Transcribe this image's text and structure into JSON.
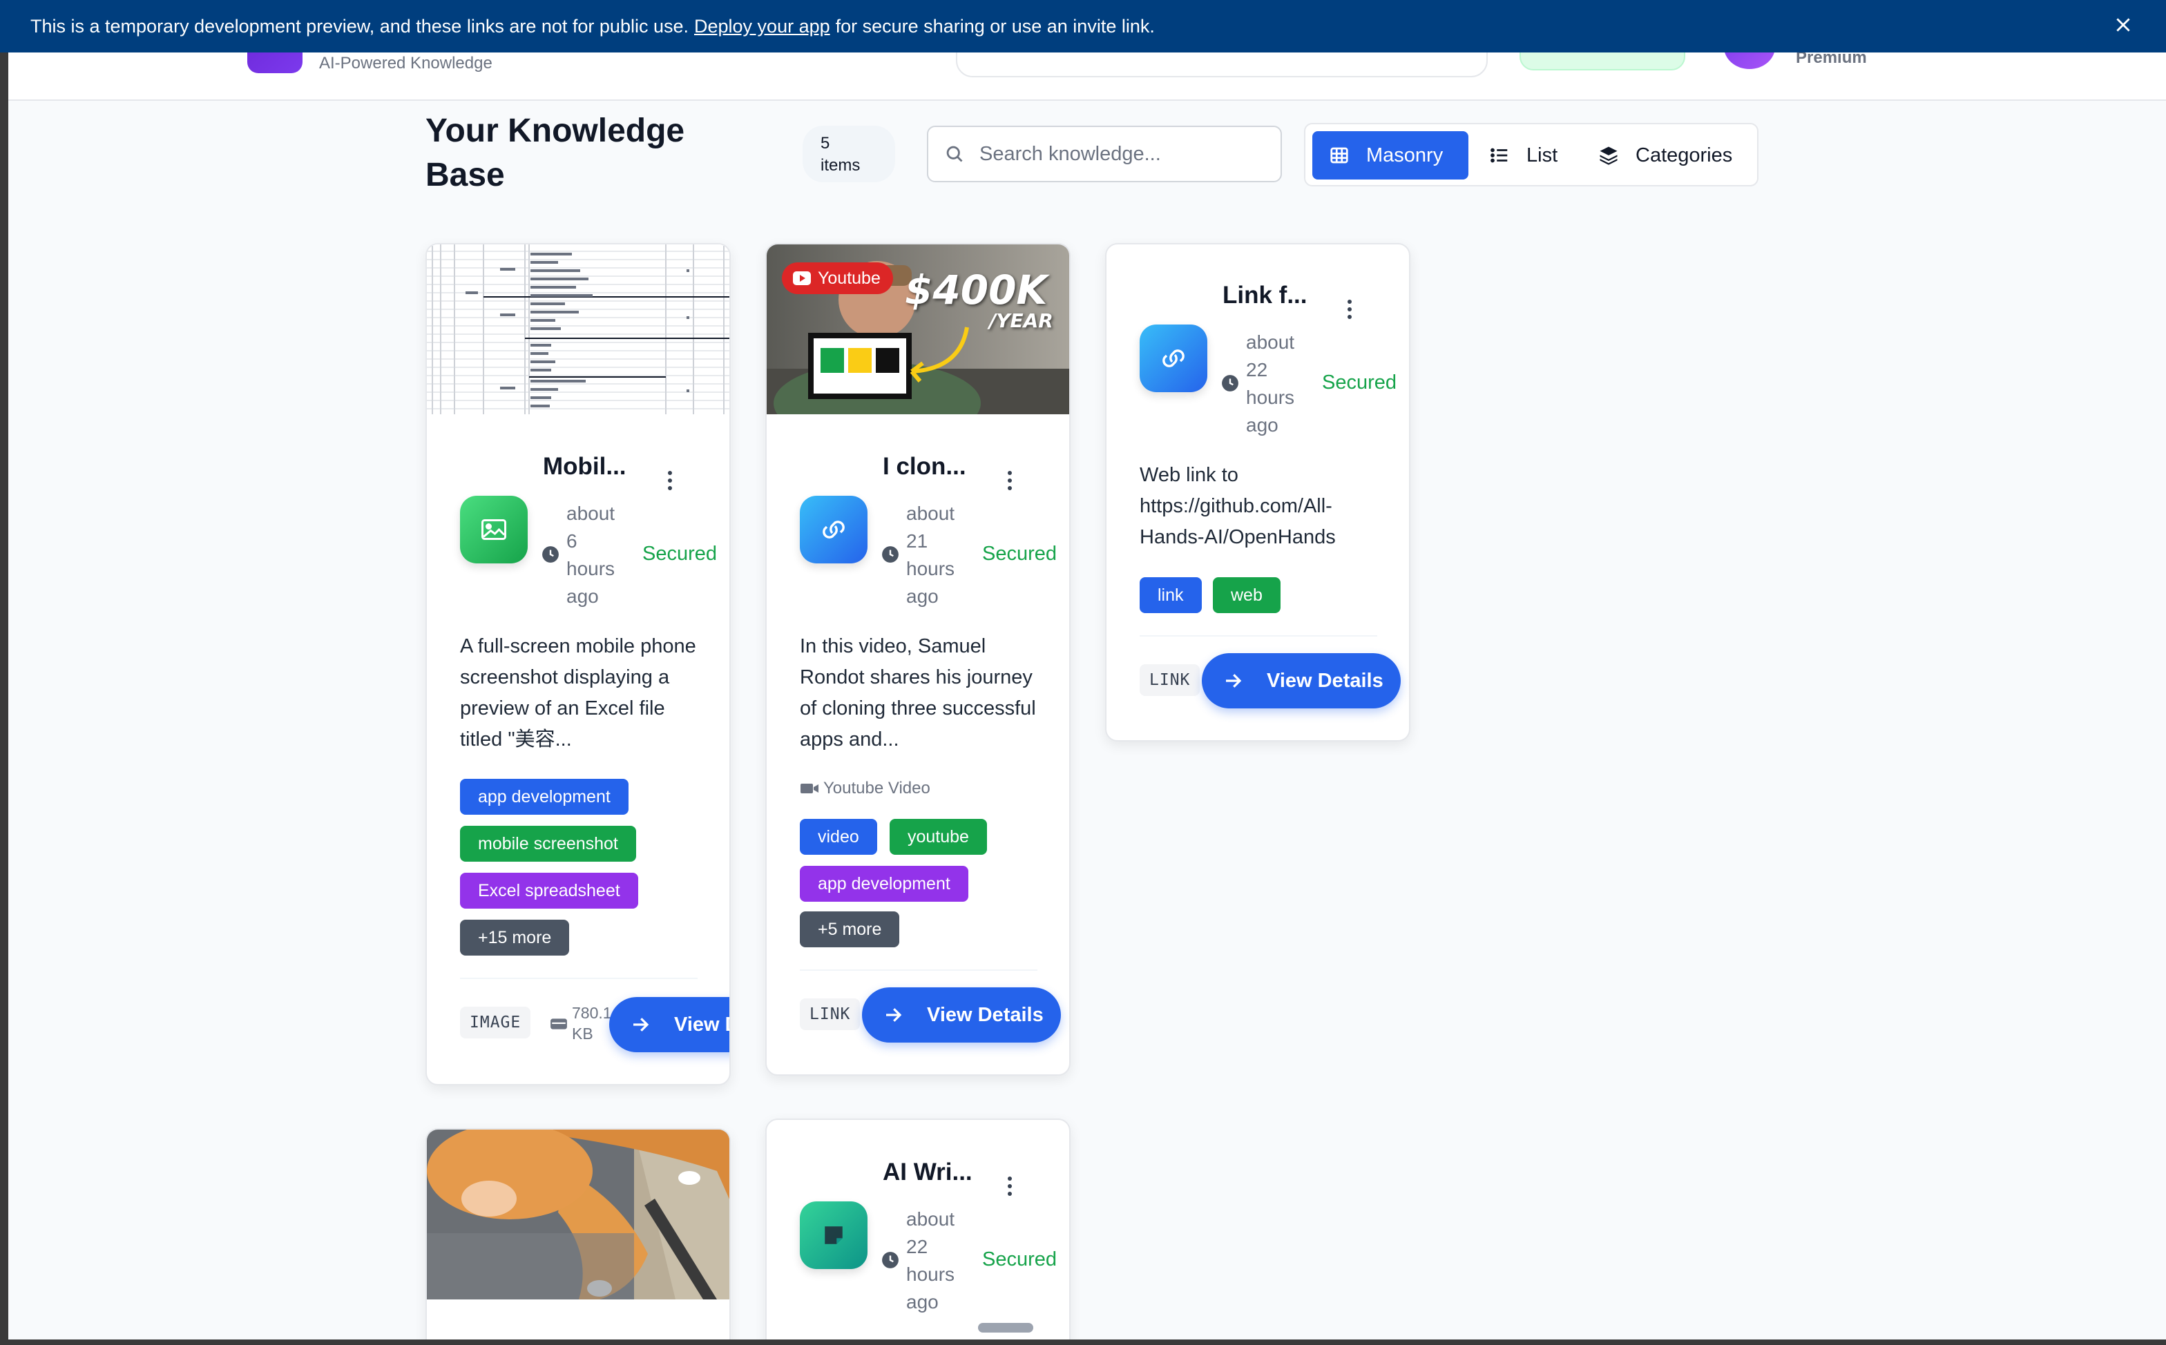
{
  "banner": {
    "text_before": "This is a temporary development preview, and these links are not for public use.",
    "link": "Deploy your app",
    "text_after": "for secure sharing or use an invite link."
  },
  "header": {
    "subtitle": "AI-Powered Knowledge",
    "plan": "Premium"
  },
  "toolbar": {
    "title": "Your Knowledge Base",
    "count_number": "5",
    "count_unit": "items",
    "search_placeholder": "Search knowledge...",
    "views": [
      "Masonry",
      "List",
      "Categories"
    ]
  },
  "colors": {
    "primary": "#2563eb",
    "secured": "#16a34a",
    "banner": "#003e7e"
  },
  "cards": [
    {
      "title": "Mobil...",
      "icon": "image-icon",
      "time": [
        "about",
        "6",
        "hours",
        "ago"
      ],
      "status": "Secured",
      "description": "A full-screen mobile phone screenshot displaying a preview of an Excel file titled \"美容...",
      "tags": [
        "app development",
        "mobile screenshot",
        "Excel spreadsheet",
        "+15 more"
      ],
      "type": "IMAGE",
      "size": [
        "780.1",
        "KB"
      ],
      "button": "View Details"
    },
    {
      "title": "I clon...",
      "icon": "link-icon",
      "badge": "Youtube",
      "thumb_text": [
        "$400K",
        "/YEAR"
      ],
      "time": [
        "about",
        "21",
        "hours",
        "ago"
      ],
      "status": "Secured",
      "description": "In this video, Samuel Rondot shares his journey of cloning three successful apps and...",
      "source": "Youtube Video",
      "tags": [
        "video",
        "youtube",
        "app development",
        "+5 more"
      ],
      "type": "LINK",
      "button": "View Details"
    },
    {
      "title": "Link f...",
      "icon": "link-icon",
      "time": [
        "about",
        "22",
        "hours",
        "ago"
      ],
      "status": "Secured",
      "description": "Web link to https://github.com/All-Hands-AI/OpenHands",
      "tags": [
        "link",
        "web"
      ],
      "type": "LINK",
      "button": "View Details"
    },
    {
      "title": "",
      "icon": "image-icon"
    },
    {
      "title": "AI Wri...",
      "icon": "note-icon",
      "time": [
        "about",
        "22",
        "hours",
        "ago"
      ],
      "status": "Secured"
    }
  ]
}
